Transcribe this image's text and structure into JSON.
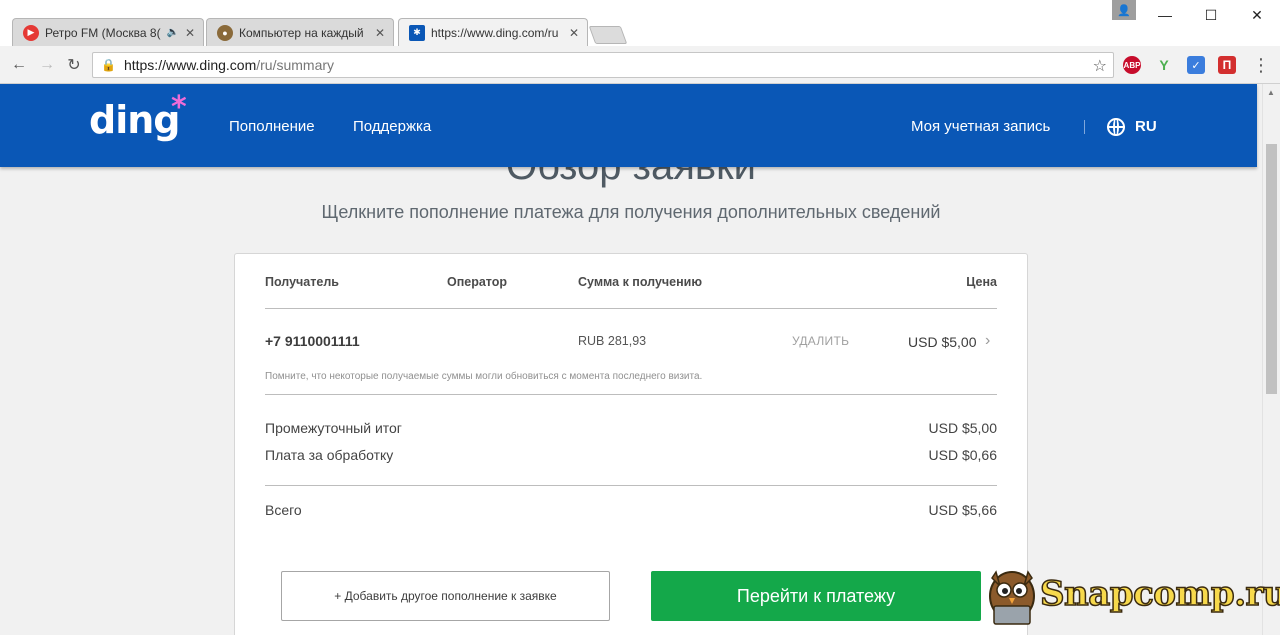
{
  "browser": {
    "tabs": [
      {
        "title": "Ретро FM (Москва 8(",
        "icon": "play-icon",
        "color": "#e53935",
        "audio": "🔈"
      },
      {
        "title": "Компьютер на каждый ",
        "icon": "owl-icon",
        "color": "#8a6a3a"
      },
      {
        "title": "https://www.ding.com/ru",
        "icon": "ding-icon",
        "color": "#0a57b6"
      }
    ],
    "url_host": "https://www.ding.com",
    "url_path": "/ru/summary",
    "window_controls": {
      "minimize": "—",
      "maximize": "☐",
      "close": "✕"
    },
    "extensions": [
      {
        "name": "adblock-icon",
        "label": "ABP",
        "color": "#c70d2c"
      },
      {
        "name": "yandex-icon",
        "label": "Y",
        "color": "#4caf50"
      },
      {
        "name": "chart-icon",
        "label": "✓",
        "color": "#3b7ddd"
      },
      {
        "name": "pocket-icon",
        "label": "Π",
        "color": "#d32f2f"
      }
    ],
    "menu_glyph": "⋮"
  },
  "site": {
    "logo": "ding",
    "logo_star": "*",
    "nav": [
      "Пополнение",
      "Поддержка"
    ],
    "account": "Моя учетная запись",
    "language": "RU",
    "brand_color": "#0a57b6"
  },
  "page": {
    "title": "Обзор заявки",
    "subtitle": "Щелкните пополнение платежа для получения дополнительных сведений"
  },
  "order": {
    "headers": {
      "recipient": "Получатель",
      "operator": "Оператор",
      "amount": "Сумма к получению",
      "price": "Цена"
    },
    "item": {
      "recipient": "+7 9110001111",
      "operator": "",
      "amount": "RUB 281,93",
      "delete": "УДАЛИТЬ",
      "price": "USD $5,00"
    },
    "note": "Помните, что некоторые получаемые суммы могли обновиться с момента последнего визита.",
    "subtotal_label": "Промежуточный итог",
    "subtotal_value": "USD $5,00",
    "fee_label": "Плата за обработку",
    "fee_value": "USD $0,66",
    "total_label": "Всего",
    "total_value": "USD $5,66",
    "add_button": "+ Добавить другое пополнение к заявке",
    "pay_button": "Перейти к платежу",
    "pay_color": "#14a84a"
  },
  "watermark": {
    "text": "Snapcomp.ru"
  }
}
